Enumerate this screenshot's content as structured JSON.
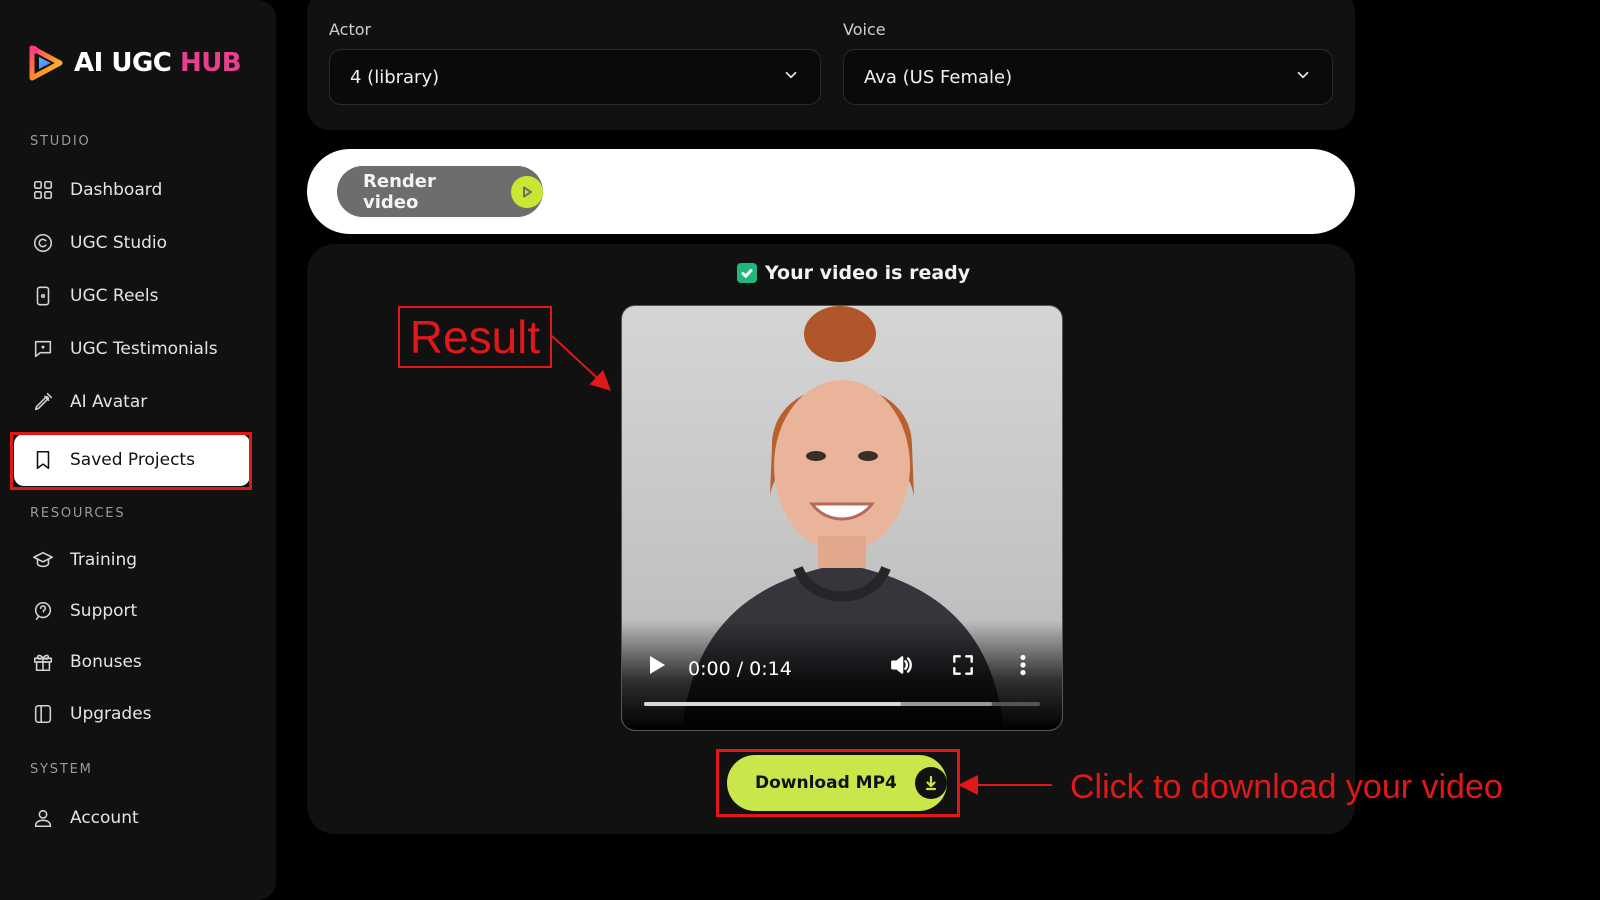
{
  "app": {
    "logo_main": "AI UGC ",
    "logo_accent": "HUB"
  },
  "sidebar": {
    "sections": {
      "studio": "STUDIO",
      "resources": "RESOURCES",
      "system": "SYSTEM"
    },
    "items": [
      {
        "label": "Dashboard",
        "icon": "grid-icon"
      },
      {
        "label": "UGC Studio",
        "icon": "copyright-circle-icon"
      },
      {
        "label": "UGC Reels",
        "icon": "phone-icon"
      },
      {
        "label": "UGC Testimonials",
        "icon": "message-square-icon"
      },
      {
        "label": "AI Avatar",
        "icon": "pen-tool-icon"
      },
      {
        "label": "Saved Projects",
        "icon": "bookmark-icon",
        "active": true
      },
      {
        "label": "Training",
        "icon": "graduation-cap-icon"
      },
      {
        "label": "Support",
        "icon": "support-badge-icon"
      },
      {
        "label": "Bonuses",
        "icon": "gift-icon"
      },
      {
        "label": "Upgrades",
        "icon": "book-icon"
      },
      {
        "label": "Account",
        "icon": "user-icon"
      }
    ]
  },
  "form": {
    "actor_label": "Actor",
    "actor_value": "4 (library)",
    "voice_label": "Voice",
    "voice_value": "Ava (US Female)"
  },
  "render": {
    "button_label": "Render video"
  },
  "result": {
    "status_text": "Your video is ready",
    "video": {
      "time": "0:00 / 0:14",
      "played_fraction": 0.65,
      "buffered_fraction": 0.88
    },
    "download_label": "Download MP4"
  },
  "annotations": {
    "result_label": "Result",
    "download_callout": "Click to download your video",
    "color": "#e01818"
  },
  "colors": {
    "accent_lime": "#c9e64a",
    "success_green": "#1fb87a",
    "background": "#000000",
    "panel": "#111111"
  }
}
